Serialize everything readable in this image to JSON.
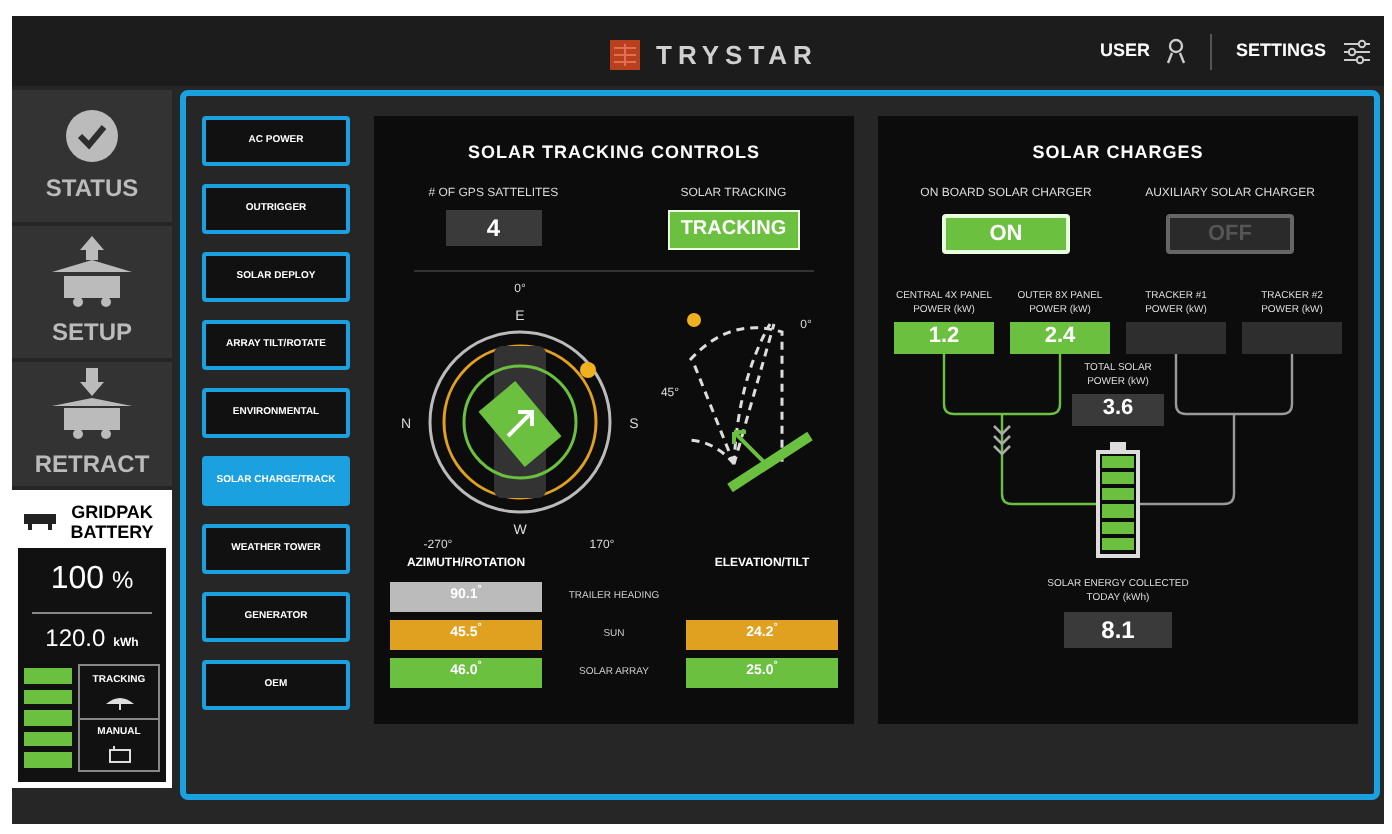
{
  "header": {
    "brand": "TRYSTAR",
    "user": "USER",
    "settings": "SETTINGS"
  },
  "nav": [
    {
      "label": "STATUS",
      "kind": "status"
    },
    {
      "label": "SETUP",
      "kind": "setup"
    },
    {
      "label": "RETRACT",
      "kind": "retract"
    }
  ],
  "battery": {
    "title": "GRIDPAK BATTERY",
    "percent": "100",
    "percent_unit": "%",
    "energy": "120.0",
    "energy_unit": "kWh",
    "level": 1,
    "modes": [
      {
        "label": "TRACKING",
        "kind": "tracking"
      },
      {
        "label": "MANUAL",
        "kind": "manual"
      }
    ]
  },
  "menu": [
    {
      "label": "AC POWER",
      "selected": false
    },
    {
      "label": "OUTRIGGER",
      "selected": false
    },
    {
      "label": "SOLAR DEPLOY",
      "selected": false
    },
    {
      "label": "ARRAY TILT/ROTATE",
      "selected": false
    },
    {
      "label": "ENVIRONMENTAL",
      "selected": false
    },
    {
      "label": "SOLAR CHARGE/TRACK",
      "selected": true
    },
    {
      "label": "WEATHER TOWER",
      "selected": false
    },
    {
      "label": "GENERATOR",
      "selected": false
    },
    {
      "label": "OEM",
      "selected": false
    }
  ],
  "tracking": {
    "title": "SOLAR TRACKING CONTROLS",
    "gps_label": "# OF GPS SATTELITES",
    "gps_value": "4",
    "tracking_label": "SOLAR TRACKING",
    "tracking_button": {
      "label": "TRACKING",
      "on": true
    },
    "compass": {
      "top": "0°",
      "north": "N",
      "east": "E",
      "south": "S",
      "west": "W",
      "left": "-270°",
      "right": "170°"
    },
    "elevation": {
      "left": "45°",
      "right": "0°"
    },
    "azimuth_heading": "AZIMUTH/ROTATION",
    "elevation_heading": "ELEVATION/TILT",
    "rows": [
      {
        "label": "TRAILER HEADING",
        "kind": "heading",
        "azimuth": "90.1$^{°}$"
      },
      {
        "label": "SUN",
        "kind": "sun",
        "azimuth": "45.5$^{°}$",
        "elevation": "24.2$^{°}$"
      },
      {
        "label": "SOLAR ARRAY",
        "kind": "array",
        "azimuth": "46.0$^{°}$",
        "elevation": "25.0$^{°}$"
      }
    ]
  },
  "charges": {
    "title": "SOLAR CHARGES",
    "chargers": [
      {
        "label": "ON BOARD SOLAR CHARGER",
        "button": "ON",
        "on": true
      },
      {
        "label": "AUXILIARY SOLAR CHARGER",
        "button": "OFF",
        "on": false
      }
    ],
    "panels": [
      {
        "label": "CENTRAL 4X PANEL POWER (kW)",
        "value": "1.2",
        "active": true
      },
      {
        "label": "OUTER 8X PANEL POWER (kW)",
        "value": "2.4",
        "active": true
      },
      {
        "label": "TRACKER #1 POWER (kW)",
        "active": false
      },
      {
        "label": "TRACKER #2 POWER (kW)",
        "active": false
      }
    ],
    "total_label": "TOTAL SOLAR POWER (kW)",
    "total": "3.6",
    "battery": {
      "level": 1
    },
    "energy_label": "SOLAR ENERGY COLLECTED TODAY (kWh)",
    "energy": "8.1"
  }
}
